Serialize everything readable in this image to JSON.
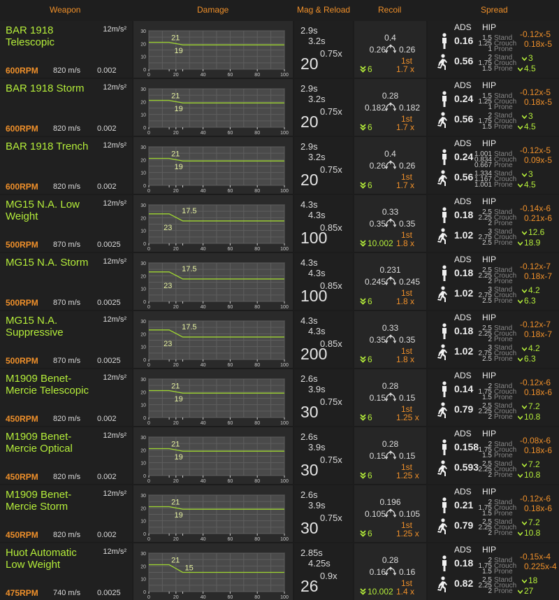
{
  "headers": {
    "weapon": "Weapon",
    "damage": "Damage",
    "mag_reload": "Mag & Reload",
    "recoil": "Recoil",
    "spread": "Spread"
  },
  "labels": {
    "ads": "ADS",
    "hip": "HIP",
    "stand": "Stand",
    "crouch": "Crouch",
    "prone": "Prone",
    "first": "1st"
  },
  "chart_ticks": {
    "y": [
      "30",
      "20",
      "10",
      "0"
    ],
    "x": [
      "0",
      "20",
      "40",
      "60",
      "80",
      "100"
    ]
  },
  "colors": {
    "accent_green": "#b5ee3a",
    "accent_orange": "#f0902a",
    "line": "#9fd630"
  },
  "icons": {
    "stand": "standing-figure-icon",
    "move": "running-figure-icon",
    "recoil": "recoil-arrows-icon",
    "down": "double-chevron-down-icon"
  },
  "rows": [
    {
      "name": "BAR 1918 Telescopic",
      "accel": "12m/s²",
      "rpm": "600RPM",
      "velocity": "820 m/s",
      "drag": "0.002",
      "damage": {
        "start": 21,
        "end": 19,
        "drop_start": 15,
        "drop_end": 25,
        "label_hi": "21",
        "label_lo": "19",
        "low_label_pos": "below"
      },
      "reload_a": "2.9s",
      "reload_b": "3.2s",
      "mult": "0.75x",
      "mag": "20",
      "recoil_up": "0.4",
      "recoil_left": "0.26",
      "recoil_right": "0.26",
      "recoil_down": "6",
      "first_mult": "1.7 x",
      "ads_stand": "0.16",
      "ads_move": "0.56",
      "hip_stand": [
        "1.5",
        "1.25",
        "1"
      ],
      "hip_move": [
        "2",
        "1.75",
        "1.5"
      ],
      "spread_inc_stand": "-0.12x-5",
      "spread_inc_crouch": "0.18x-5",
      "spread_dec1": "3",
      "spread_dec2": "4.5"
    },
    {
      "name": "BAR 1918 Storm",
      "accel": "12m/s²",
      "rpm": "600RPM",
      "velocity": "820 m/s",
      "drag": "0.002",
      "damage": {
        "start": 21,
        "end": 19,
        "drop_start": 15,
        "drop_end": 25,
        "label_hi": "21",
        "label_lo": "19",
        "low_label_pos": "below"
      },
      "reload_a": "2.9s",
      "reload_b": "3.2s",
      "mult": "0.75x",
      "mag": "20",
      "recoil_up": "0.28",
      "recoil_left": "0.182",
      "recoil_right": "0.182",
      "recoil_down": "6",
      "first_mult": "1.7 x",
      "ads_stand": "0.24",
      "ads_move": "0.56",
      "hip_stand": [
        "1.5",
        "1.25",
        "1"
      ],
      "hip_move": [
        "2",
        "1.75",
        "1.5"
      ],
      "spread_inc_stand": "-0.12x-5",
      "spread_inc_crouch": "0.18x-5",
      "spread_dec1": "3",
      "spread_dec2": "4.5"
    },
    {
      "name": "BAR 1918 Trench",
      "accel": "12m/s²",
      "rpm": "600RPM",
      "velocity": "820 m/s",
      "drag": "0.002",
      "damage": {
        "start": 21,
        "end": 19,
        "drop_start": 15,
        "drop_end": 25,
        "label_hi": "21",
        "label_lo": "19",
        "low_label_pos": "below"
      },
      "reload_a": "2.9s",
      "reload_b": "3.2s",
      "mult": "0.75x",
      "mag": "20",
      "recoil_up": "0.4",
      "recoil_left": "0.26",
      "recoil_right": "0.26",
      "recoil_down": "6",
      "first_mult": "1.7 x",
      "ads_stand": "0.24",
      "ads_move": "0.56",
      "hip_stand": [
        "1.001",
        "0.834",
        "0.667"
      ],
      "hip_move": [
        "1.334",
        "1.167",
        "1.001"
      ],
      "spread_inc_stand": "-0.12x-5",
      "spread_inc_crouch": "0.09x-5",
      "spread_dec1": "3",
      "spread_dec2": "4.5"
    },
    {
      "name": "MG15 N.A. Low Weight",
      "accel": "12m/s²",
      "rpm": "500RPM",
      "velocity": "870 m/s",
      "drag": "0.0025",
      "damage": {
        "start": 23,
        "end": 17.5,
        "drop_start": 15,
        "drop_end": 25,
        "label_hi": "17.5",
        "label_lo": "23",
        "low_label_pos": "swap"
      },
      "reload_a": "4.3s",
      "reload_b": "4.3s",
      "mult": "0.85x",
      "mag": "100",
      "recoil_up": "0.33",
      "recoil_left": "0.35",
      "recoil_right": "0.35",
      "recoil_down": "10.002",
      "first_mult": "1.8 x",
      "ads_stand": "0.18",
      "ads_move": "1.02",
      "hip_stand": [
        "2.5",
        "2.25",
        "2"
      ],
      "hip_move": [
        "3",
        "2.75",
        "2.5"
      ],
      "spread_inc_stand": "-0.14x-6",
      "spread_inc_crouch": "0.21x-6",
      "spread_dec1": "12.6",
      "spread_dec2": "18.9"
    },
    {
      "name": "MG15 N.A. Storm",
      "accel": "12m/s²",
      "rpm": "500RPM",
      "velocity": "870 m/s",
      "drag": "0.0025",
      "damage": {
        "start": 23,
        "end": 17.5,
        "drop_start": 15,
        "drop_end": 25,
        "label_hi": "17.5",
        "label_lo": "23",
        "low_label_pos": "swap"
      },
      "reload_a": "4.3s",
      "reload_b": "4.3s",
      "mult": "0.85x",
      "mag": "100",
      "recoil_up": "0.231",
      "recoil_left": "0.245",
      "recoil_right": "0.245",
      "recoil_down": "6",
      "first_mult": "1.8 x",
      "ads_stand": "0.18",
      "ads_move": "1.02",
      "hip_stand": [
        "2.5",
        "2.25",
        "2"
      ],
      "hip_move": [
        "3",
        "2.75",
        "2.5"
      ],
      "spread_inc_stand": "-0.12x-7",
      "spread_inc_crouch": "0.18x-7",
      "spread_dec1": "4.2",
      "spread_dec2": "6.3"
    },
    {
      "name": "MG15 N.A. Suppressive",
      "accel": "12m/s²",
      "rpm": "500RPM",
      "velocity": "870 m/s",
      "drag": "0.0025",
      "damage": {
        "start": 23,
        "end": 17.5,
        "drop_start": 15,
        "drop_end": 25,
        "label_hi": "17.5",
        "label_lo": "23",
        "low_label_pos": "swap"
      },
      "reload_a": "4.3s",
      "reload_b": "4.3s",
      "mult": "0.85x",
      "mag": "200",
      "recoil_up": "0.33",
      "recoil_left": "0.35",
      "recoil_right": "0.35",
      "recoil_down": "6",
      "first_mult": "1.8 x",
      "ads_stand": "0.18",
      "ads_move": "1.02",
      "hip_stand": [
        "2.5",
        "2.25",
        "2"
      ],
      "hip_move": [
        "3",
        "2.75",
        "2.5"
      ],
      "spread_inc_stand": "-0.12x-7",
      "spread_inc_crouch": "0.18x-7",
      "spread_dec1": "4.2",
      "spread_dec2": "6.3"
    },
    {
      "name": "M1909 Benet-Mercie Telescopic",
      "accel": "12m/s²",
      "rpm": "450RPM",
      "velocity": "820 m/s",
      "drag": "0.002",
      "damage": {
        "start": 21,
        "end": 19,
        "drop_start": 15,
        "drop_end": 25,
        "label_hi": "21",
        "label_lo": "19",
        "low_label_pos": "below"
      },
      "reload_a": "2.6s",
      "reload_b": "3.9s",
      "mult": "0.75x",
      "mag": "30",
      "recoil_up": "0.28",
      "recoil_left": "0.15",
      "recoil_right": "0.15",
      "recoil_down": "6",
      "first_mult": "1.25 x",
      "ads_stand": "0.14",
      "ads_move": "0.79",
      "hip_stand": [
        "2",
        "1.75",
        "1.5"
      ],
      "hip_move": [
        "2.5",
        "2.25",
        "2"
      ],
      "spread_inc_stand": "-0.12x-6",
      "spread_inc_crouch": "0.18x-6",
      "spread_dec1": "7.2",
      "spread_dec2": "10.8"
    },
    {
      "name": "M1909 Benet-Mercie Optical",
      "accel": "12m/s²",
      "rpm": "450RPM",
      "velocity": "820 m/s",
      "drag": "0.002",
      "damage": {
        "start": 21,
        "end": 19,
        "drop_start": 15,
        "drop_end": 25,
        "label_hi": "21",
        "label_lo": "19",
        "low_label_pos": "below"
      },
      "reload_a": "2.6s",
      "reload_b": "3.9s",
      "mult": "0.75x",
      "mag": "30",
      "recoil_up": "0.28",
      "recoil_left": "0.15",
      "recoil_right": "0.15",
      "recoil_down": "6",
      "first_mult": "1.25 x",
      "ads_stand": "0.158",
      "ads_move": "0.593",
      "hip_stand": [
        "2",
        "1.75",
        "1.5"
      ],
      "hip_move": [
        "2.5",
        "2.25",
        "2"
      ],
      "spread_inc_stand": "-0.08x-6",
      "spread_inc_crouch": "0.18x-6",
      "spread_dec1": "7.2",
      "spread_dec2": "10.8"
    },
    {
      "name": "M1909 Benet-Mercie Storm",
      "accel": "12m/s²",
      "rpm": "450RPM",
      "velocity": "820 m/s",
      "drag": "0.002",
      "damage": {
        "start": 21,
        "end": 19,
        "drop_start": 15,
        "drop_end": 25,
        "label_hi": "21",
        "label_lo": "19",
        "low_label_pos": "below"
      },
      "reload_a": "2.6s",
      "reload_b": "3.9s",
      "mult": "0.75x",
      "mag": "30",
      "recoil_up": "0.196",
      "recoil_left": "0.105",
      "recoil_right": "0.105",
      "recoil_down": "6",
      "first_mult": "1.25 x",
      "ads_stand": "0.21",
      "ads_move": "0.79",
      "hip_stand": [
        "2",
        "1.75",
        "1.5"
      ],
      "hip_move": [
        "2.5",
        "2.25",
        "2"
      ],
      "spread_inc_stand": "-0.12x-6",
      "spread_inc_crouch": "0.18x-6",
      "spread_dec1": "7.2",
      "spread_dec2": "10.8"
    },
    {
      "name": "Huot Automatic Low Weight",
      "accel": "12m/s²",
      "rpm": "475RPM",
      "velocity": "740 m/s",
      "drag": "0.0025",
      "damage": {
        "start": 21,
        "end": 15,
        "drop_start": 15,
        "drop_end": 25,
        "label_hi": "21",
        "label_lo": "15",
        "low_label_pos": "right"
      },
      "reload_a": "2.85s",
      "reload_b": "4.25s",
      "mult": "0.9x",
      "mag": "26",
      "recoil_up": "0.28",
      "recoil_left": "0.16",
      "recoil_right": "0.16",
      "recoil_down": "10.002",
      "first_mult": "1.4 x",
      "ads_stand": "0.18",
      "ads_move": "0.82",
      "hip_stand": [
        "2",
        "1.75",
        "1.5"
      ],
      "hip_move": [
        "2.5",
        "2.25",
        "2"
      ],
      "spread_inc_stand": "-0.15x-4",
      "spread_inc_crouch": "0.225x-4",
      "spread_dec1": "18",
      "spread_dec2": "27"
    }
  ]
}
